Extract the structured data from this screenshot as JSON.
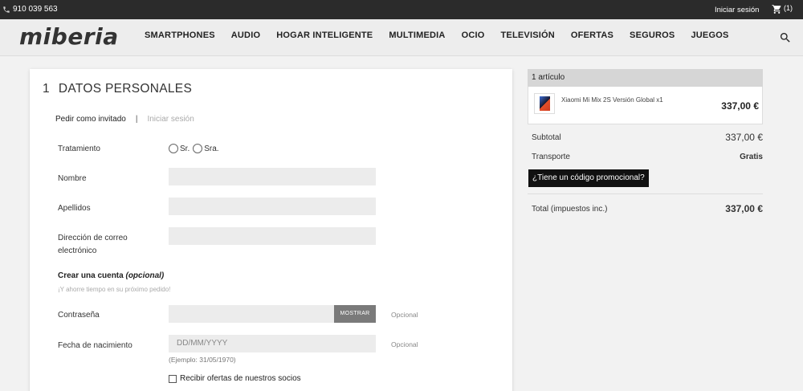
{
  "topbar": {
    "phone": "910 039 563",
    "login": "Iniciar sesión",
    "cart_count": "(1)"
  },
  "header": {
    "logo": "miberia",
    "nav": [
      "SMARTPHONES",
      "AUDIO",
      "HOGAR INTELIGENTE",
      "MULTIMEDIA",
      "OCIO",
      "TELEVISIÓN",
      "OFERTAS",
      "SEGUROS",
      "JUEGOS"
    ]
  },
  "form": {
    "step_number": "1",
    "step_title": "DATOS PERSONALES",
    "tab_guest": "Pedir como invitado",
    "tab_sep": "|",
    "tab_login": "Iniciar sesión",
    "tratamiento_label": "Tratamiento",
    "radio_sr": "Sr.",
    "radio_sra": "Sra.",
    "nombre_label": "Nombre",
    "apellidos_label": "Apellidos",
    "email_label_1": "Dirección de correo",
    "email_label_2": "electrónico",
    "crear_label": "Crear una cuenta",
    "crear_optional": "(opcional)",
    "crear_hint": "¡Y ahorre tiempo en su próximo pedido!",
    "password_label": "Contraseña",
    "show_button": "MOSTRAR",
    "optional_1": "Opcional",
    "birth_label": "Fecha de nacimiento",
    "birth_placeholder": "DD/MM/YYYY",
    "birth_example": "(Ejemplo: 31/05/1970)",
    "optional_2": "Opcional",
    "offers_label": "Recibir ofertas de nuestros socios"
  },
  "summary": {
    "count": "1 artículo",
    "item_name": "Xiaomi Mi Mix 2S Versión Global x1",
    "item_price": "337,00 €",
    "subtotal_label": "Subtotal",
    "subtotal_value": "337,00 €",
    "shipping_label": "Transporte",
    "shipping_value": "Gratis",
    "promo_link": "¿Tiene un código promocional?",
    "total_label": "Total (impuestos inc.)",
    "total_value": "337,00 €"
  }
}
